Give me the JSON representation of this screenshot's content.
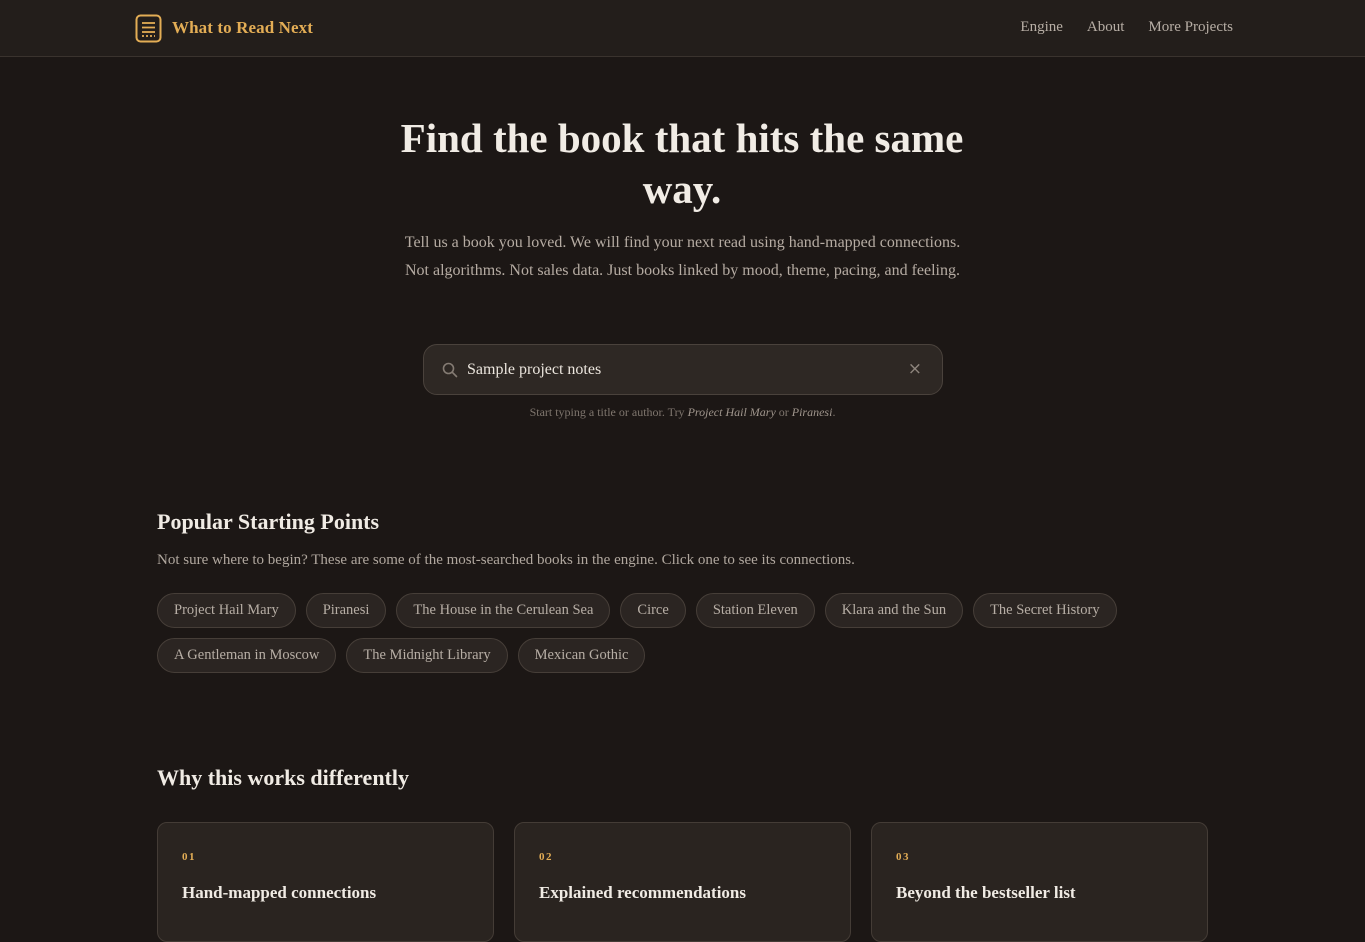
{
  "header": {
    "brand": "What to Read Next",
    "nav": [
      "Engine",
      "About",
      "More Projects"
    ]
  },
  "hero": {
    "title": "Find the book that hits the same way.",
    "subtitle": "Tell us a book you loved. We will find your next read using hand-mapped connections. Not algorithms. Not sales data. Just books linked by mood, theme, pacing, and feeling."
  },
  "search": {
    "value": "Sample project notes",
    "clear_symbol": "×",
    "hint_prefix": "Start typing a title or author. Try ",
    "hint_example_1": "Project Hail Mary",
    "hint_or": " or ",
    "hint_example_2": "Piranesi",
    "hint_suffix": "."
  },
  "popular": {
    "title": "Popular Starting Points",
    "description": "Not sure where to begin? These are some of the most-searched books in the engine. Click one to see its connections.",
    "books": [
      "Project Hail Mary",
      "Piranesi",
      "The House in the Cerulean Sea",
      "Circe",
      "Station Eleven",
      "Klara and the Sun",
      "The Secret History",
      "A Gentleman in Moscow",
      "The Midnight Library",
      "Mexican Gothic"
    ]
  },
  "why": {
    "title": "Why this works differently",
    "cards": [
      {
        "num": "01",
        "title": "Hand-mapped connections"
      },
      {
        "num": "02",
        "title": "Explained recommendations"
      },
      {
        "num": "03",
        "title": "Beyond the bestseller list"
      }
    ]
  },
  "colors": {
    "accent": "#e3ad55",
    "background": "#1c1715",
    "header_bg": "#231e1b"
  }
}
